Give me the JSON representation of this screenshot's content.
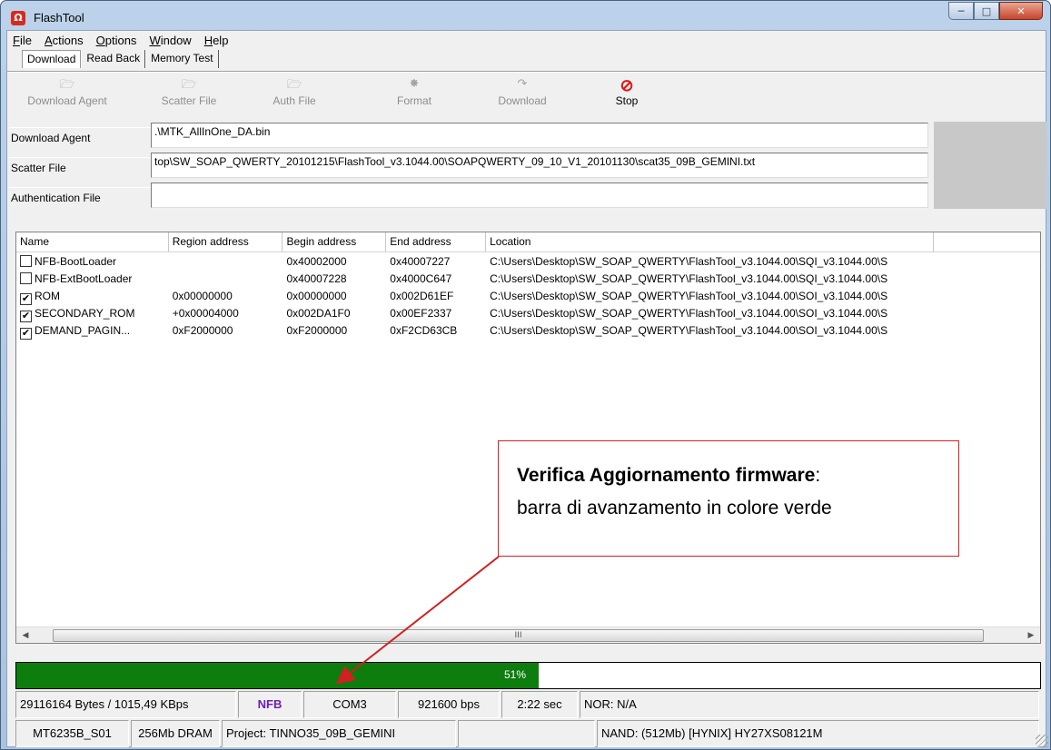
{
  "window": {
    "title": "FlashTool"
  },
  "menu": [
    "File",
    "Actions",
    "Options",
    "Window",
    "Help"
  ],
  "tabs": [
    "Download",
    "Read Back",
    "Memory Test"
  ],
  "toolbar": {
    "download_agent": "Download Agent",
    "scatter_file": "Scatter File",
    "auth_file": "Auth File",
    "format": "Format",
    "download": "Download",
    "stop": "Stop"
  },
  "fields": {
    "download_agent": {
      "label": "Download Agent",
      "value": ".\\MTK_AllInOne_DA.bin"
    },
    "scatter_file": {
      "label": "Scatter File",
      "value": "top\\SW_SOAP_QWERTY_20101215\\FlashTool_v3.1044.00\\SOAPQWERTY_09_10_V1_20101130\\scat35_09B_GEMINI.txt"
    },
    "auth_file": {
      "label": "Authentication File",
      "value": ""
    }
  },
  "table": {
    "headers": [
      "Name",
      "Region address",
      "Begin address",
      "End address",
      "Location"
    ],
    "rows": [
      {
        "checked": false,
        "name": "NFB-BootLoader",
        "region": "",
        "begin": "0x40002000",
        "end": "0x40007227",
        "location": "C:\\Users\\Desktop\\SW_SOAP_QWERTY\\FlashTool_v3.1044.00\\SQI_v3.1044.00\\S"
      },
      {
        "checked": false,
        "name": "NFB-ExtBootLoader",
        "region": "",
        "begin": "0x40007228",
        "end": "0x4000C647",
        "location": "C:\\Users\\Desktop\\SW_SOAP_QWERTY\\FlashTool_v3.1044.00\\SQI_v3.1044.00\\S"
      },
      {
        "checked": true,
        "name": "ROM",
        "region": "0x00000000",
        "begin": "0x00000000",
        "end": "0x002D61EF",
        "location": "C:\\Users\\Desktop\\SW_SOAP_QWERTY\\FlashTool_v3.1044.00\\SOI_v3.1044.00\\S"
      },
      {
        "checked": true,
        "name": "SECONDARY_ROM",
        "region": "+0x00004000",
        "begin": "0x002DA1F0",
        "end": "0x00EF2337",
        "location": "C:\\Users\\Desktop\\SW_SOAP_QWERTY\\FlashTool_v3.1044.00\\SOI_v3.1044.00\\S"
      },
      {
        "checked": true,
        "name": "DEMAND_PAGIN...",
        "region": "0xF2000000",
        "begin": "0xF2000000",
        "end": "0xF2CD63CB",
        "location": "C:\\Users\\Desktop\\SW_SOAP_QWERTY\\FlashTool_v3.1044.00\\SOI_v3.1044.00\\S"
      }
    ],
    "scroll_thumb": "III"
  },
  "callout": {
    "bold": "Verifica Aggiornamento firmware",
    "colon": ":",
    "line2": "barra di avanzamento in colore verde"
  },
  "progress": {
    "percent": 51,
    "label": "51%",
    "color": "#0d7d0d"
  },
  "status1": {
    "bytes": "29116164 Bytes / 1015,49 KBps",
    "type": "NFB",
    "port": "COM3",
    "baud": "921600 bps",
    "time": "2:22 sec",
    "nor": "NOR: N/A"
  },
  "status2": {
    "chip": "MT6235B_S01",
    "dram": "256Mb DRAM",
    "project": "Project: TINNO35_09B_GEMINI",
    "blank": "",
    "nand": "NAND: (512Mb) [HYNIX] HY27XS08121M"
  },
  "colors": {
    "accent_red": "#d21f1f",
    "progress_green": "#0d7d0d",
    "nfb_purple": "#6a1eb8"
  }
}
